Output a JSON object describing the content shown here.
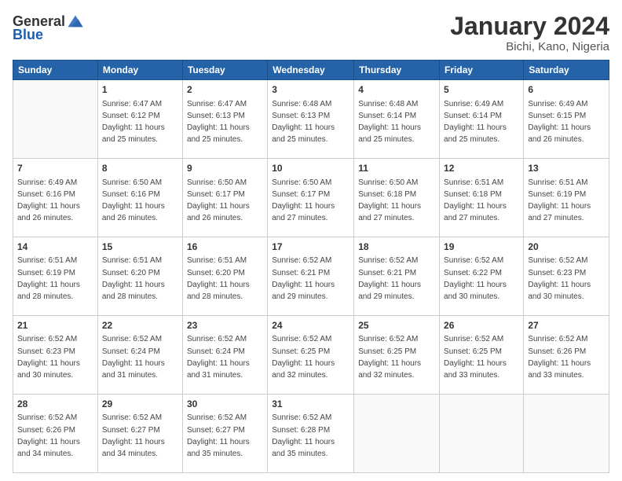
{
  "logo": {
    "general": "General",
    "blue": "Blue"
  },
  "title": "January 2024",
  "subtitle": "Bichi, Kano, Nigeria",
  "headers": [
    "Sunday",
    "Monday",
    "Tuesday",
    "Wednesday",
    "Thursday",
    "Friday",
    "Saturday"
  ],
  "weeks": [
    [
      {
        "day": "",
        "info": ""
      },
      {
        "day": "1",
        "info": "Sunrise: 6:47 AM\nSunset: 6:12 PM\nDaylight: 11 hours\nand 25 minutes."
      },
      {
        "day": "2",
        "info": "Sunrise: 6:47 AM\nSunset: 6:13 PM\nDaylight: 11 hours\nand 25 minutes."
      },
      {
        "day": "3",
        "info": "Sunrise: 6:48 AM\nSunset: 6:13 PM\nDaylight: 11 hours\nand 25 minutes."
      },
      {
        "day": "4",
        "info": "Sunrise: 6:48 AM\nSunset: 6:14 PM\nDaylight: 11 hours\nand 25 minutes."
      },
      {
        "day": "5",
        "info": "Sunrise: 6:49 AM\nSunset: 6:14 PM\nDaylight: 11 hours\nand 25 minutes."
      },
      {
        "day": "6",
        "info": "Sunrise: 6:49 AM\nSunset: 6:15 PM\nDaylight: 11 hours\nand 26 minutes."
      }
    ],
    [
      {
        "day": "7",
        "info": "Sunrise: 6:49 AM\nSunset: 6:16 PM\nDaylight: 11 hours\nand 26 minutes."
      },
      {
        "day": "8",
        "info": "Sunrise: 6:50 AM\nSunset: 6:16 PM\nDaylight: 11 hours\nand 26 minutes."
      },
      {
        "day": "9",
        "info": "Sunrise: 6:50 AM\nSunset: 6:17 PM\nDaylight: 11 hours\nand 26 minutes."
      },
      {
        "day": "10",
        "info": "Sunrise: 6:50 AM\nSunset: 6:17 PM\nDaylight: 11 hours\nand 27 minutes."
      },
      {
        "day": "11",
        "info": "Sunrise: 6:50 AM\nSunset: 6:18 PM\nDaylight: 11 hours\nand 27 minutes."
      },
      {
        "day": "12",
        "info": "Sunrise: 6:51 AM\nSunset: 6:18 PM\nDaylight: 11 hours\nand 27 minutes."
      },
      {
        "day": "13",
        "info": "Sunrise: 6:51 AM\nSunset: 6:19 PM\nDaylight: 11 hours\nand 27 minutes."
      }
    ],
    [
      {
        "day": "14",
        "info": "Sunrise: 6:51 AM\nSunset: 6:19 PM\nDaylight: 11 hours\nand 28 minutes."
      },
      {
        "day": "15",
        "info": "Sunrise: 6:51 AM\nSunset: 6:20 PM\nDaylight: 11 hours\nand 28 minutes."
      },
      {
        "day": "16",
        "info": "Sunrise: 6:51 AM\nSunset: 6:20 PM\nDaylight: 11 hours\nand 28 minutes."
      },
      {
        "day": "17",
        "info": "Sunrise: 6:52 AM\nSunset: 6:21 PM\nDaylight: 11 hours\nand 29 minutes."
      },
      {
        "day": "18",
        "info": "Sunrise: 6:52 AM\nSunset: 6:21 PM\nDaylight: 11 hours\nand 29 minutes."
      },
      {
        "day": "19",
        "info": "Sunrise: 6:52 AM\nSunset: 6:22 PM\nDaylight: 11 hours\nand 30 minutes."
      },
      {
        "day": "20",
        "info": "Sunrise: 6:52 AM\nSunset: 6:23 PM\nDaylight: 11 hours\nand 30 minutes."
      }
    ],
    [
      {
        "day": "21",
        "info": "Sunrise: 6:52 AM\nSunset: 6:23 PM\nDaylight: 11 hours\nand 30 minutes."
      },
      {
        "day": "22",
        "info": "Sunrise: 6:52 AM\nSunset: 6:24 PM\nDaylight: 11 hours\nand 31 minutes."
      },
      {
        "day": "23",
        "info": "Sunrise: 6:52 AM\nSunset: 6:24 PM\nDaylight: 11 hours\nand 31 minutes."
      },
      {
        "day": "24",
        "info": "Sunrise: 6:52 AM\nSunset: 6:25 PM\nDaylight: 11 hours\nand 32 minutes."
      },
      {
        "day": "25",
        "info": "Sunrise: 6:52 AM\nSunset: 6:25 PM\nDaylight: 11 hours\nand 32 minutes."
      },
      {
        "day": "26",
        "info": "Sunrise: 6:52 AM\nSunset: 6:25 PM\nDaylight: 11 hours\nand 33 minutes."
      },
      {
        "day": "27",
        "info": "Sunrise: 6:52 AM\nSunset: 6:26 PM\nDaylight: 11 hours\nand 33 minutes."
      }
    ],
    [
      {
        "day": "28",
        "info": "Sunrise: 6:52 AM\nSunset: 6:26 PM\nDaylight: 11 hours\nand 34 minutes."
      },
      {
        "day": "29",
        "info": "Sunrise: 6:52 AM\nSunset: 6:27 PM\nDaylight: 11 hours\nand 34 minutes."
      },
      {
        "day": "30",
        "info": "Sunrise: 6:52 AM\nSunset: 6:27 PM\nDaylight: 11 hours\nand 35 minutes."
      },
      {
        "day": "31",
        "info": "Sunrise: 6:52 AM\nSunset: 6:28 PM\nDaylight: 11 hours\nand 35 minutes."
      },
      {
        "day": "",
        "info": ""
      },
      {
        "day": "",
        "info": ""
      },
      {
        "day": "",
        "info": ""
      }
    ]
  ]
}
